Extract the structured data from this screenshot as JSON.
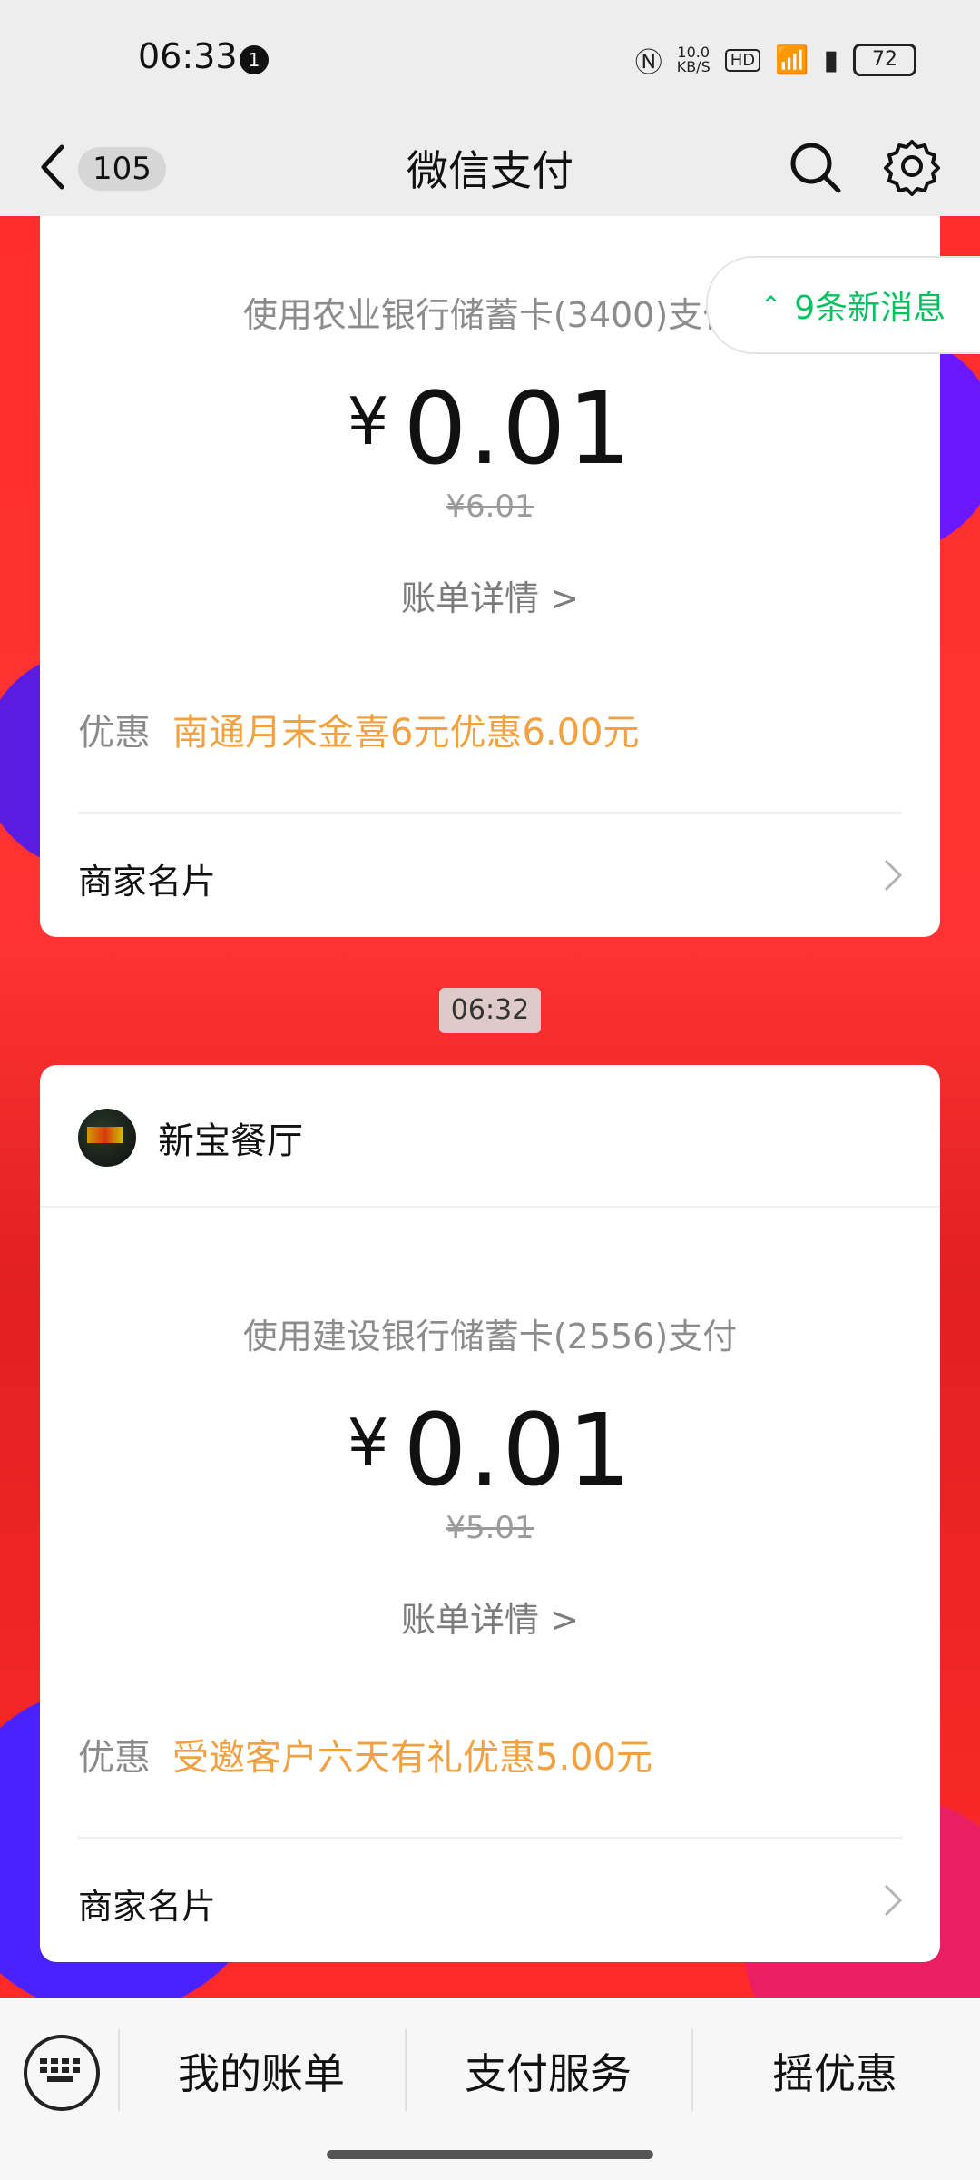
{
  "status": {
    "time": "06:33",
    "notif_count": "1",
    "speed_top": "10.0",
    "speed_bottom": "KB/S",
    "hd": "HD",
    "battery": "72"
  },
  "nav": {
    "unread": "105",
    "title": "微信支付"
  },
  "new_messages": "9条新消息",
  "card1": {
    "pay_method": "使用农业银行储蓄卡(3400)支付",
    "currency": "¥",
    "amount": "0.01",
    "original": "¥6.01",
    "detail": "账单详情 >",
    "discount_label": "优惠",
    "discount_text": "南通月末金喜6元优惠6.00元",
    "merchant_card": "商家名片"
  },
  "timestamp": "06:32",
  "card2": {
    "merchant_name": "新宝餐厅",
    "pay_method": "使用建设银行储蓄卡(2556)支付",
    "currency": "¥",
    "amount": "0.01",
    "original": "¥5.01",
    "detail": "账单详情 >",
    "discount_label": "优惠",
    "discount_text": "受邀客户六天有礼优惠5.00元",
    "merchant_card": "商家名片"
  },
  "bottom_tabs": [
    "我的账单",
    "支付服务",
    "摇优惠"
  ]
}
